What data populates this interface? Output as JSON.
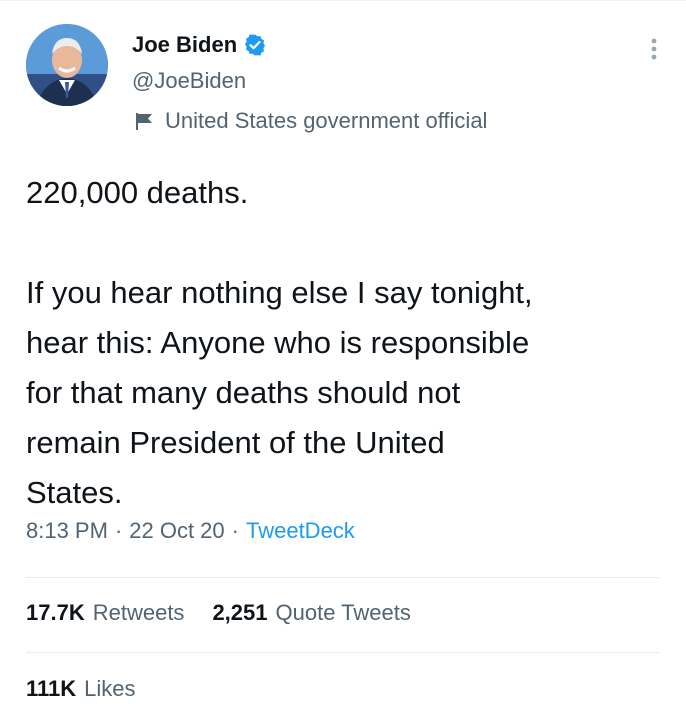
{
  "tweet": {
    "author": {
      "name": "Joe Biden",
      "handle": "@JoeBiden",
      "label": "United States government official"
    },
    "text": {
      "line1": "220,000 deaths.",
      "para2_l1": "If you hear nothing else I say tonight,",
      "para2_l2": "hear this: Anyone who is responsible",
      "para2_l3": "for that many deaths should not",
      "para2_l4": "remain President of the United",
      "para2_l5": "States."
    },
    "meta": {
      "time": "8:13 PM",
      "separator": "·",
      "date": "22 Oct 20",
      "source": "TweetDeck"
    },
    "stats": {
      "retweets_count": "17.7K",
      "retweets_label": "Retweets",
      "quotes_count": "2,251",
      "quotes_label": "Quote Tweets",
      "likes_count": "111K",
      "likes_label": "Likes"
    }
  },
  "colors": {
    "text_primary": "#0f1419",
    "text_secondary": "#536471",
    "accent": "#1d9bf0",
    "divider": "#e6ecf0"
  },
  "icons": {
    "verified": "verified-badge-icon",
    "label": "flag-icon",
    "more": "more-vertical-icon"
  }
}
